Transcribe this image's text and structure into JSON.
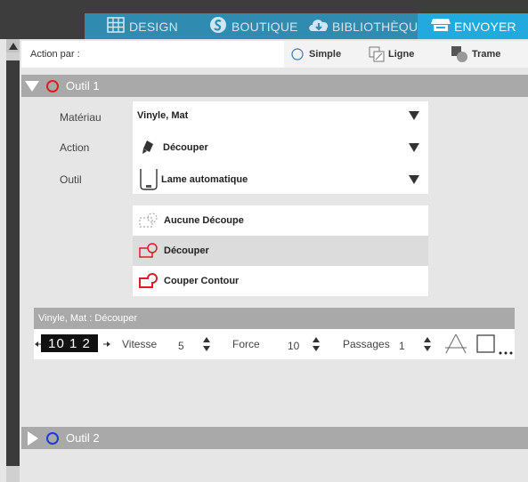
{
  "tabs": [
    {
      "label": "DESIGN",
      "icon": "grid-icon"
    },
    {
      "label": "BOUTIQUE",
      "icon": "silhouette-s-icon"
    },
    {
      "label": "BIBLIOTHÈQUE",
      "icon": "cloud-download-icon"
    },
    {
      "label": "ENVOYER",
      "icon": "send-machine-icon",
      "active": true
    }
  ],
  "action_bar": {
    "label": "Action par :",
    "modes": [
      {
        "label": "Simple",
        "icon": "radio-circle-icon",
        "selected": true
      },
      {
        "label": "Ligne",
        "icon": "line-mode-icon"
      },
      {
        "label": "Trame",
        "icon": "fill-mode-icon"
      }
    ]
  },
  "tool1": {
    "name": "Outil 1",
    "color": "#e01b24",
    "fields": {
      "material_label": "Matériau",
      "material_value": "Vinyle, Mat",
      "action_label": "Action",
      "action_value": "Découper",
      "tool_label": "Outil",
      "tool_value": "Lame automatique"
    },
    "cut_options": [
      {
        "label": "Aucune Découpe",
        "icon": "no-cut-icon"
      },
      {
        "label": "Découper",
        "icon": "cut-icon",
        "selected": true
      },
      {
        "label": "Couper Contour",
        "icon": "cut-edge-icon"
      }
    ]
  },
  "settings": {
    "title": "Vinyle, Mat : Découper",
    "blade_digits": "10 1 2",
    "speed_label": "Vitesse",
    "speed_value": "5",
    "force_label": "Force",
    "force_value": "10",
    "passes_label": "Passages",
    "passes_value": "1"
  },
  "tool2": {
    "name": "Outil 2",
    "color": "#1d3ad6"
  },
  "colors": {
    "tab_bar": "#2f8bb0",
    "tab_active": "#22a9de",
    "header_gray": "#a9a9a9",
    "cut_red": "#e01b24"
  }
}
